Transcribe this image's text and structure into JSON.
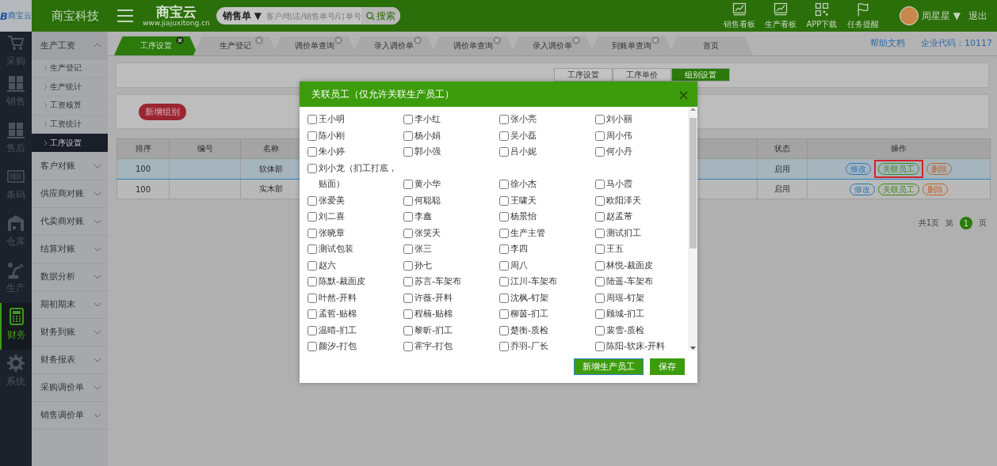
{
  "header": {
    "logo": {
      "mark": "B",
      "text": "商宝云"
    },
    "company": "商宝科技",
    "brand": {
      "name": "商宝云",
      "url": "www.jiajuxitong.cn"
    },
    "search": {
      "scope": "销售单 ▼",
      "placeholder": "客户/电话/销售单号/订单号",
      "button": "搜索"
    },
    "nav": [
      {
        "label": "销售看板",
        "kind": "chart"
      },
      {
        "label": "生产看板",
        "kind": "chart"
      },
      {
        "label": "APP下载",
        "kind": "qr"
      },
      {
        "label": "任务提醒",
        "kind": "flag"
      }
    ],
    "user": {
      "name": "周星星 ▼",
      "logout": "退出"
    }
  },
  "rail": [
    {
      "label": "采购",
      "kind": "cart",
      "selected": false
    },
    {
      "label": "销售",
      "kind": "boxes",
      "selected": false
    },
    {
      "label": "售后",
      "kind": "boxes",
      "selected": false
    },
    {
      "label": "条码",
      "kind": "barcode",
      "selected": false
    },
    {
      "label": "仓库",
      "kind": "warehouse",
      "selected": false
    },
    {
      "label": "生产",
      "kind": "robot",
      "selected": false
    },
    {
      "label": "财务",
      "kind": "calculator",
      "selected": true
    },
    {
      "label": "系统",
      "kind": "gear",
      "selected": false
    }
  ],
  "sidebar": [
    {
      "label": "生产工资",
      "expanded": true,
      "children": [
        {
          "label": "生产登记",
          "selected": false
        },
        {
          "label": "生产统计",
          "selected": false
        },
        {
          "label": "工资核算",
          "selected": false
        },
        {
          "label": "工资统计",
          "selected": false
        },
        {
          "label": "工序设置",
          "selected": true
        }
      ]
    },
    {
      "label": "客户对账",
      "expanded": false
    },
    {
      "label": "供应商对账",
      "expanded": false
    },
    {
      "label": "代卖商对账",
      "expanded": false
    },
    {
      "label": "结算对账",
      "expanded": false
    },
    {
      "label": "数据分析",
      "expanded": false
    },
    {
      "label": "期初期末",
      "expanded": false
    },
    {
      "label": "财务到账",
      "expanded": false
    },
    {
      "label": "财务报表",
      "expanded": false
    },
    {
      "label": "采购调价单",
      "expanded": false
    },
    {
      "label": "销售调价单",
      "expanded": false
    }
  ],
  "tabs": [
    {
      "label": "工序设置",
      "selected": true,
      "closable": true
    },
    {
      "label": "生产登记",
      "selected": false,
      "closable": true
    },
    {
      "label": "调价单查询",
      "selected": false,
      "closable": true
    },
    {
      "label": "录入调价单",
      "selected": false,
      "closable": true
    },
    {
      "label": "调价单查询",
      "selected": false,
      "closable": true
    },
    {
      "label": "录入调价单",
      "selected": false,
      "closable": true
    },
    {
      "label": "到账单查询",
      "selected": false,
      "closable": true
    },
    {
      "label": "首页",
      "selected": false,
      "closable": false
    }
  ],
  "help_link": "帮助文档",
  "company_code": "企业代码：10117",
  "subtabs": [
    {
      "label": "工序设置",
      "selected": false
    },
    {
      "label": "工序单价",
      "selected": false
    },
    {
      "label": "组别设置",
      "selected": true
    }
  ],
  "add_group_button": "新增组别",
  "table": {
    "columns": [
      "排序",
      "编号",
      "名称",
      "状态",
      "操作"
    ],
    "rows": [
      {
        "order": "100",
        "name": "软体部",
        "status": "启用",
        "selected": true,
        "actions": [
          {
            "label": "修改",
            "kind": "edit",
            "highlighted": false
          },
          {
            "label": "关联员工",
            "kind": "link",
            "highlighted": true
          },
          {
            "label": "删除",
            "kind": "delete",
            "highlighted": false
          }
        ]
      },
      {
        "order": "100",
        "name": "实木部",
        "status": "启用",
        "selected": false,
        "actions": [
          {
            "label": "修改",
            "kind": "edit",
            "highlighted": false
          },
          {
            "label": "关联员工",
            "kind": "link",
            "highlighted": false
          },
          {
            "label": "删除",
            "kind": "delete",
            "highlighted": false
          }
        ]
      }
    ]
  },
  "pagination": {
    "total": "共1页",
    "prefix": "第",
    "current": "1",
    "suffix": "页"
  },
  "dialog": {
    "title": "关联员工（仅允许关联生产员工）",
    "close": "×",
    "employees": [
      {
        "name": "王小明",
        "checked": false
      },
      {
        "name": "李小红",
        "checked": false
      },
      {
        "name": "张小亮",
        "checked": false
      },
      {
        "name": "刘小丽",
        "checked": false
      },
      {
        "name": "陈小刚",
        "checked": false
      },
      {
        "name": "杨小娟",
        "checked": false
      },
      {
        "name": "吴小磊",
        "checked": false
      },
      {
        "name": "周小伟",
        "checked": false
      },
      {
        "name": "朱小婷",
        "checked": false
      },
      {
        "name": "郭小强",
        "checked": false
      },
      {
        "name": "吕小妮",
        "checked": false
      },
      {
        "name": "何小丹",
        "checked": false
      },
      {
        "name": "刘小龙（扪工打底，贴面）",
        "checked": false
      },
      {
        "name": "黄小华",
        "checked": false
      },
      {
        "name": "徐小杰",
        "checked": false
      },
      {
        "name": "马小霞",
        "checked": false
      },
      {
        "name": "张爱美",
        "checked": false
      },
      {
        "name": "何聪聪",
        "checked": false
      },
      {
        "name": "王啸天",
        "checked": false
      },
      {
        "name": "欧阳泽天",
        "checked": false
      },
      {
        "name": "刘二喜",
        "checked": false
      },
      {
        "name": "李鑫",
        "checked": false
      },
      {
        "name": "杨景怡",
        "checked": false
      },
      {
        "name": "赵孟芾",
        "checked": false
      },
      {
        "name": "张晓章",
        "checked": false
      },
      {
        "name": "张笑天",
        "checked": false
      },
      {
        "name": "生产主管",
        "checked": false
      },
      {
        "name": "测试扪工",
        "checked": false
      },
      {
        "name": "测试包装",
        "checked": false
      },
      {
        "name": "张三",
        "checked": false
      },
      {
        "name": "李四",
        "checked": false
      },
      {
        "name": "王五",
        "checked": false
      },
      {
        "name": "赵六",
        "checked": false
      },
      {
        "name": "孙七",
        "checked": false
      },
      {
        "name": "周八",
        "checked": false
      },
      {
        "name": "林悦-裁面皮",
        "checked": false
      },
      {
        "name": "陈默-裁面皮",
        "checked": false
      },
      {
        "name": "苏言-车架布",
        "checked": false
      },
      {
        "name": "江川-车架布",
        "checked": false
      },
      {
        "name": "陆遥-车架布",
        "checked": false
      },
      {
        "name": "叶然-开料",
        "checked": false
      },
      {
        "name": "许薇-开料",
        "checked": false
      },
      {
        "name": "沈枫-钉架",
        "checked": false
      },
      {
        "name": "周瑶-钉架",
        "checked": false
      },
      {
        "name": "孟哲-贴棉",
        "checked": false
      },
      {
        "name": "程楠-贴棉",
        "checked": false
      },
      {
        "name": "柳茵-扪工",
        "checked": false
      },
      {
        "name": "顾城-扪工",
        "checked": false
      },
      {
        "name": "温晴-扪工",
        "checked": false
      },
      {
        "name": "黎昕-扪工",
        "checked": false
      },
      {
        "name": "楚衡-质检",
        "checked": false
      },
      {
        "name": "裴雪-质检",
        "checked": false
      },
      {
        "name": "颜汐-打包",
        "checked": false
      },
      {
        "name": "霍宇-打包",
        "checked": false
      },
      {
        "name": "乔羽-厂长",
        "checked": false
      },
      {
        "name": "陈阳-软床-开料",
        "checked": false
      }
    ],
    "buttons": [
      "新增生产员工",
      "保存"
    ]
  }
}
